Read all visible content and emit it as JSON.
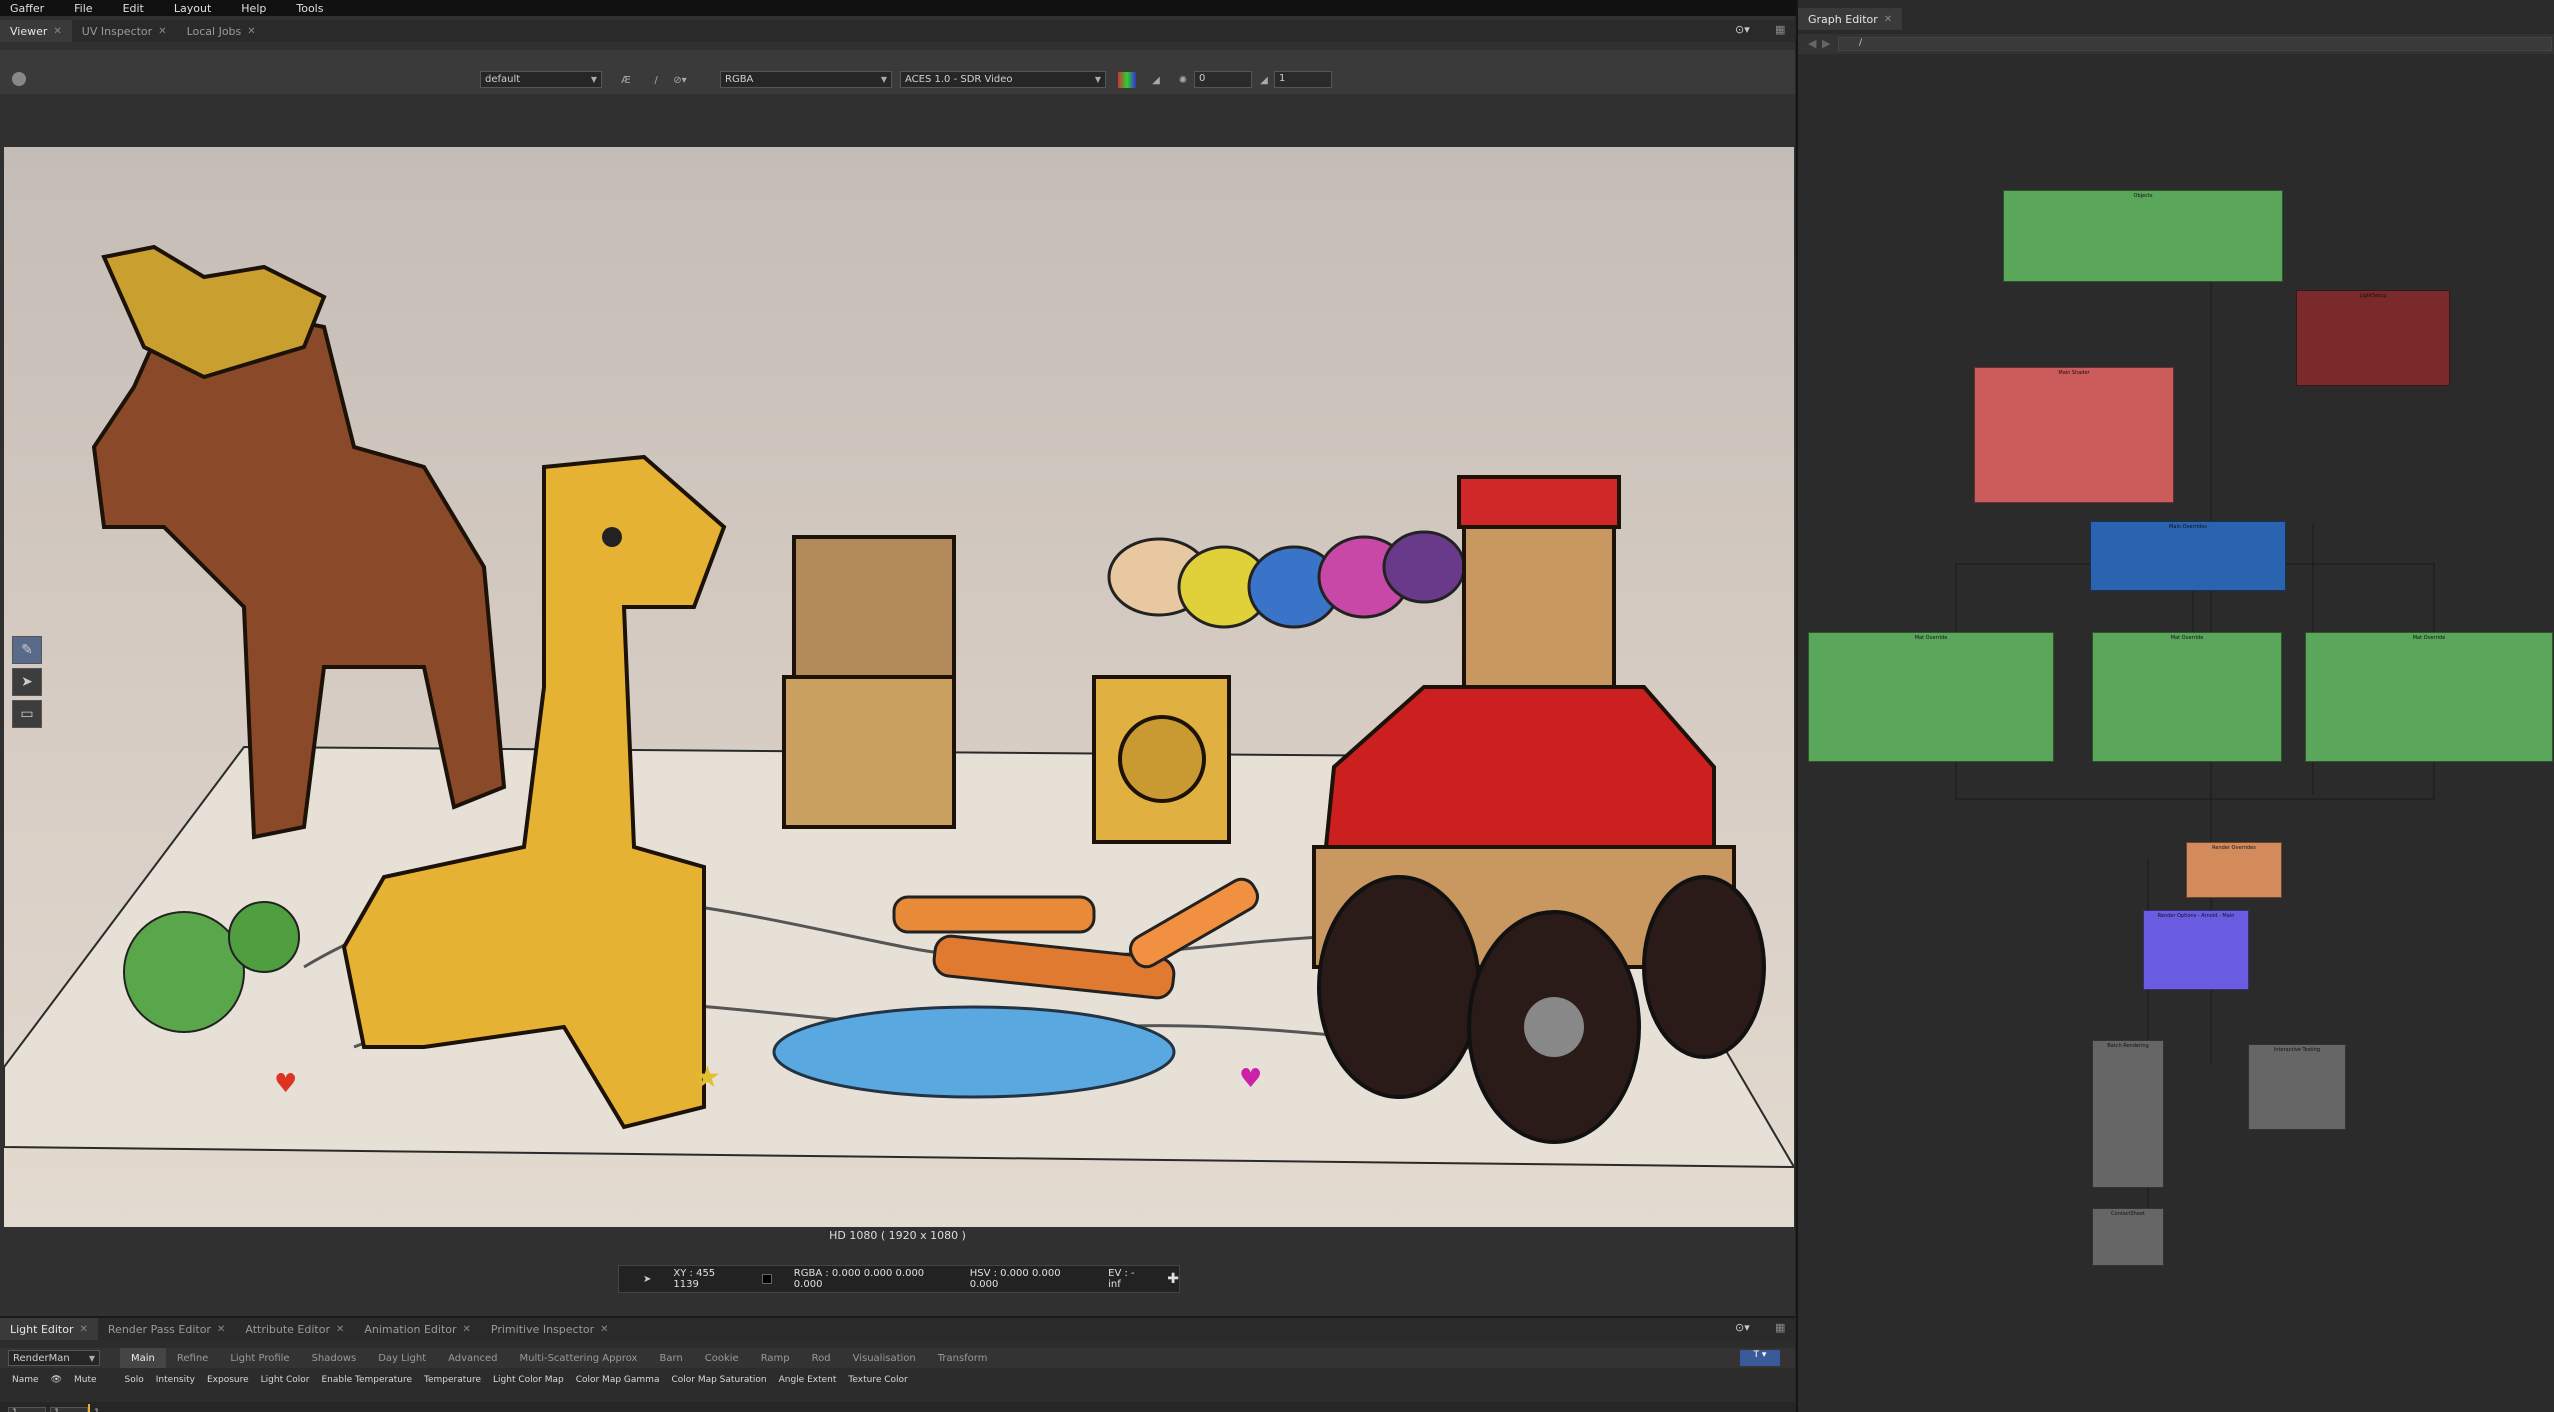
{
  "menu": [
    "Gaffer",
    "File",
    "Edit",
    "Layout",
    "Help",
    "Tools"
  ],
  "viewer_tabs": [
    {
      "label": "Viewer",
      "active": true
    },
    {
      "label": "UV Inspector",
      "active": false
    },
    {
      "label": "Local Jobs",
      "active": false
    }
  ],
  "viewer_toolbar": {
    "camera": "default",
    "channels": "RGBA",
    "display_transform": "ACES 1.0 - SDR Video",
    "exposure": "0",
    "gamma": "1"
  },
  "viewport": {
    "resolution_label": "HD 1080 ( 1920 x 1080 )"
  },
  "pixel_readout": {
    "xy": "XY : 455 1139",
    "rgba": "RGBA : 0.000 0.000 0.000 0.000",
    "hsv": "HSV : 0.000 0.000 0.000",
    "ev": "EV : -inf"
  },
  "bottom_tabs": [
    {
      "label": "Light Editor",
      "active": true
    },
    {
      "label": "Render Pass Editor",
      "active": false
    },
    {
      "label": "Attribute Editor",
      "active": false
    },
    {
      "label": "Animation Editor",
      "active": false
    },
    {
      "label": "Primitive Inspector",
      "active": false
    }
  ],
  "renderer": "RenderMan",
  "sub_tabs": [
    "Main",
    "Refine",
    "Light Profile",
    "Shadows",
    "Day Light",
    "Advanced",
    "Multi-Scattering Approx",
    "Barn",
    "Cookie",
    "Ramp",
    "Rod",
    "Visualisation",
    "Transform"
  ],
  "columns": [
    "Name",
    "Mute",
    "Solo",
    "Intensity",
    "Exposure",
    "Light Color",
    "Enable Temperature",
    "Temperature",
    "Light Color Map",
    "Color Map Gamma",
    "Color Map Saturation",
    "Angle Extent",
    "Texture Color"
  ],
  "timeline": {
    "start": "1",
    "current": "1",
    "marker": "1"
  },
  "graph_editor": {
    "tab": "Graph Editor",
    "path": "/",
    "nodes": [
      {
        "title": "Objects",
        "color": "#5aa65a"
      },
      {
        "title": "LightSetup",
        "color": "#7a2a2a"
      },
      {
        "title": "Main Shader",
        "color": "#cc5c5c"
      },
      {
        "title": "Main Overrides",
        "color": "#2a64b0"
      },
      {
        "title": "Mat Override",
        "color": "#5aa65a"
      },
      {
        "title": "Mat Override",
        "color": "#5aa65a"
      },
      {
        "title": "Mat Override",
        "color": "#5aa65a"
      },
      {
        "title": "Render Overrides",
        "color": "#d38b5c"
      },
      {
        "title": "Render Options - Arnold - Main",
        "color": "#6a5ce0"
      },
      {
        "title": "Batch Rendering",
        "color": "#666666"
      },
      {
        "title": "Interactive Testing",
        "color": "#666666"
      },
      {
        "title": "ContactSheet",
        "color": "#666666"
      }
    ]
  }
}
